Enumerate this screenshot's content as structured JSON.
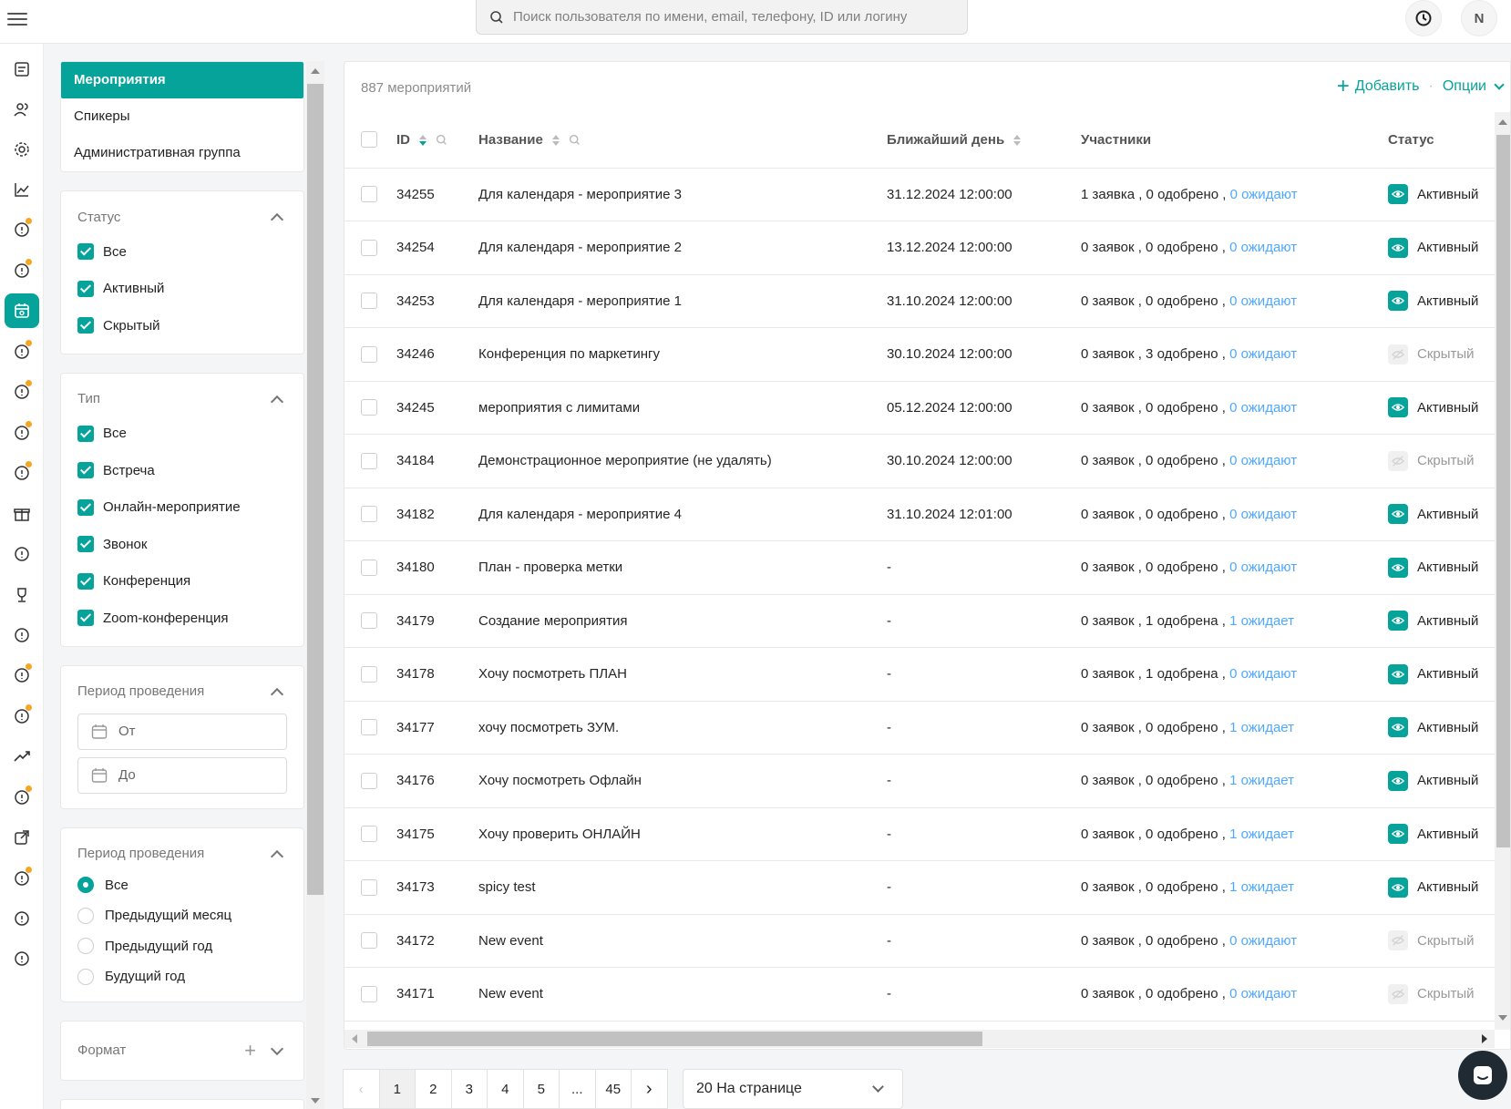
{
  "search": {
    "placeholder": "Поиск пользователя по имени, email, телефону, ID или логину"
  },
  "header": {
    "avatar_letter": "N"
  },
  "sections": [
    {
      "label": "Мероприятия",
      "active": true
    },
    {
      "label": "Спикеры",
      "active": false
    },
    {
      "label": "Административная группа",
      "active": false
    }
  ],
  "filters": {
    "status": {
      "title": "Статус",
      "options": [
        {
          "label": "Все",
          "checked": true
        },
        {
          "label": "Активный",
          "checked": true
        },
        {
          "label": "Скрытый",
          "checked": true
        }
      ]
    },
    "type": {
      "title": "Тип",
      "options": [
        {
          "label": "Все",
          "checked": true
        },
        {
          "label": "Встреча",
          "checked": true
        },
        {
          "label": "Онлайн-мероприятие",
          "checked": true
        },
        {
          "label": "Звонок",
          "checked": true
        },
        {
          "label": "Конференция",
          "checked": true
        },
        {
          "label": "Zoom-конференция",
          "checked": true
        }
      ]
    },
    "period_dates": {
      "title": "Период проведения",
      "from_placeholder": "От",
      "to_placeholder": "До"
    },
    "period_preset": {
      "title": "Период проведения",
      "options": [
        {
          "label": "Все",
          "selected": true
        },
        {
          "label": "Предыдущий месяц",
          "selected": false
        },
        {
          "label": "Предыдущий год",
          "selected": false
        },
        {
          "label": "Будущий год",
          "selected": false
        }
      ]
    },
    "format": {
      "title": "Формат"
    }
  },
  "table": {
    "count_label": "887 мероприятий",
    "add_label": "Добавить",
    "options_label": "Опции",
    "columns": {
      "id": "ID",
      "name": "Название",
      "date": "Ближайший день",
      "participants": "Участники",
      "status": "Статус"
    },
    "rows": [
      {
        "id": "34255",
        "name": "Для календаря - мероприятие 3",
        "date": "31.12.2024 12:00:00",
        "participants": "1 заявка , 0 одобрено , ",
        "waiting": "0 ожидают",
        "status": "Активный",
        "active": true
      },
      {
        "id": "34254",
        "name": "Для календаря - мероприятие 2",
        "date": "13.12.2024 12:00:00",
        "participants": "0 заявок , 0 одобрено , ",
        "waiting": "0 ожидают",
        "status": "Активный",
        "active": true
      },
      {
        "id": "34253",
        "name": "Для календаря - мероприятие 1",
        "date": "31.10.2024 12:00:00",
        "participants": "0 заявок , 0 одобрено , ",
        "waiting": "0 ожидают",
        "status": "Активный",
        "active": true
      },
      {
        "id": "34246",
        "name": "Конференция по маркетингу",
        "date": "30.10.2024 12:00:00",
        "participants": "0 заявок , 3 одобрено , ",
        "waiting": "0 ожидают",
        "status": "Скрытый",
        "active": false
      },
      {
        "id": "34245",
        "name": "мероприятия с лимитами",
        "date": "05.12.2024 12:00:00",
        "participants": "0 заявок , 0 одобрено , ",
        "waiting": "0 ожидают",
        "status": "Активный",
        "active": true
      },
      {
        "id": "34184",
        "name": "Демонстрационное мероприятие (не удалять)",
        "date": "30.10.2024 12:00:00",
        "participants": "0 заявок , 0 одобрено , ",
        "waiting": "0 ожидают",
        "status": "Скрытый",
        "active": false
      },
      {
        "id": "34182",
        "name": "Для календаря - мероприятие 4",
        "date": "31.10.2024 12:01:00",
        "participants": "0 заявок , 0 одобрено , ",
        "waiting": "0 ожидают",
        "status": "Активный",
        "active": true
      },
      {
        "id": "34180",
        "name": "План - проверка метки",
        "date": "-",
        "participants": "0 заявок , 0 одобрено , ",
        "waiting": "0 ожидают",
        "status": "Активный",
        "active": true
      },
      {
        "id": "34179",
        "name": "Создание мероприятия",
        "date": "-",
        "participants": "0 заявок , 1 одобрена , ",
        "waiting": "1 ожидает",
        "status": "Активный",
        "active": true
      },
      {
        "id": "34178",
        "name": "Хочу посмотреть ПЛАН",
        "date": "-",
        "participants": "0 заявок , 1 одобрена , ",
        "waiting": "0 ожидают",
        "status": "Активный",
        "active": true
      },
      {
        "id": "34177",
        "name": "хочу посмотреть ЗУМ.",
        "date": "-",
        "participants": "0 заявок , 0 одобрено , ",
        "waiting": "1 ожидает",
        "status": "Активный",
        "active": true
      },
      {
        "id": "34176",
        "name": "Хочу посмотреть Офлайн",
        "date": "-",
        "participants": "0 заявок , 0 одобрено , ",
        "waiting": "1 ожидает",
        "status": "Активный",
        "active": true
      },
      {
        "id": "34175",
        "name": "Хочу проверить ОНЛАЙН",
        "date": "-",
        "participants": "0 заявок , 0 одобрено , ",
        "waiting": "1 ожидает",
        "status": "Активный",
        "active": true
      },
      {
        "id": "34173",
        "name": "spicy test",
        "date": "-",
        "participants": "0 заявок , 0 одобрено , ",
        "waiting": "1 ожидает",
        "status": "Активный",
        "active": true
      },
      {
        "id": "34172",
        "name": "New event",
        "date": "-",
        "participants": "0 заявок , 0 одобрено , ",
        "waiting": "0 ожидают",
        "status": "Скрытый",
        "active": false
      },
      {
        "id": "34171",
        "name": "New event",
        "date": "-",
        "participants": "0 заявок , 0 одобрено , ",
        "waiting": "0 ожидают",
        "status": "Скрытый",
        "active": false
      }
    ]
  },
  "pagination": {
    "pages": [
      "1",
      "2",
      "3",
      "4",
      "5",
      "...",
      "45"
    ],
    "current": "1",
    "per_page": "20 На странице"
  },
  "rail_icons": [
    "news-icon",
    "users-icon",
    "settings-icon",
    "analytics-icon",
    "tasks-icon",
    "documents-icon",
    "events-icon",
    "ideas-icon",
    "chat-icon",
    "video-icon",
    "info-badge-icon",
    "gift-icon",
    "info-icon",
    "trophy-icon",
    "user-check-icon",
    "sliders-icon",
    "badge-check-icon",
    "trend-icon",
    "gauge-icon",
    "external-link-icon",
    "checklist-icon",
    "help-icon",
    "speedometer-icon"
  ],
  "colors": {
    "accent": "#05a39a",
    "link": "#4fa8ff",
    "badge": "#f5a623"
  }
}
